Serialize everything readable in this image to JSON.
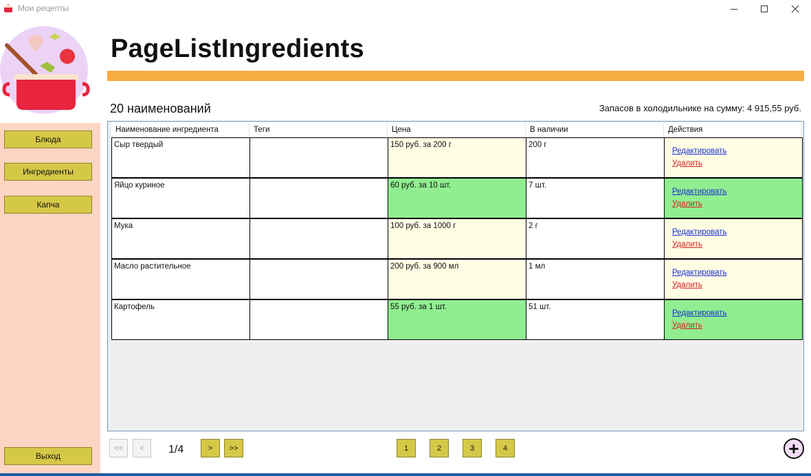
{
  "window": {
    "title": "Мои рецепты"
  },
  "header": {
    "title": "PageListIngredients",
    "count_text": "20 наименований",
    "fridge_text": "Запасов в холодильнике на сумму: 4 915,55 руб."
  },
  "sidebar": {
    "items": [
      {
        "label": "Блюда"
      },
      {
        "label": "Ингредиенты"
      },
      {
        "label": "Капча"
      }
    ],
    "exit_label": "Выход"
  },
  "table": {
    "columns": [
      "Наименование ингредиента",
      "Теги",
      "Цена",
      "В наличии",
      "Действия"
    ],
    "edit_label": "Редактировать",
    "delete_label": "Удалить",
    "rows": [
      {
        "name": "Сыр твердый",
        "tags": "",
        "price": "150 руб. за 200 г",
        "stock": "200 г",
        "status": "cream"
      },
      {
        "name": "Яйцо куриное",
        "tags": "",
        "price": "60 руб. за 10 шт.",
        "stock": "7 шт.",
        "status": "green"
      },
      {
        "name": "Мука",
        "tags": "",
        "price": "100 руб. за 1000 г",
        "stock": "2 г",
        "status": "cream"
      },
      {
        "name": "Масло растительное",
        "tags": "",
        "price": "200 руб. за 900 мл",
        "stock": "1 мл",
        "status": "cream"
      },
      {
        "name": "Картофель",
        "tags": "",
        "price": "55 руб. за 1 шт.",
        "stock": "51 шт.",
        "status": "green"
      }
    ]
  },
  "pagination": {
    "first_label": "<<",
    "prev_label": "<",
    "page_indicator": "1/4",
    "next_label": ">",
    "last_label": ">>",
    "pages": [
      "1",
      "2",
      "3",
      "4"
    ]
  },
  "add_label": "+",
  "colors": {
    "accent": "#f7ad43",
    "sidebar": "#fdd5c2",
    "button": "#d6c847",
    "in_stock": "#90ee90",
    "low_stock": "#fffde4"
  }
}
